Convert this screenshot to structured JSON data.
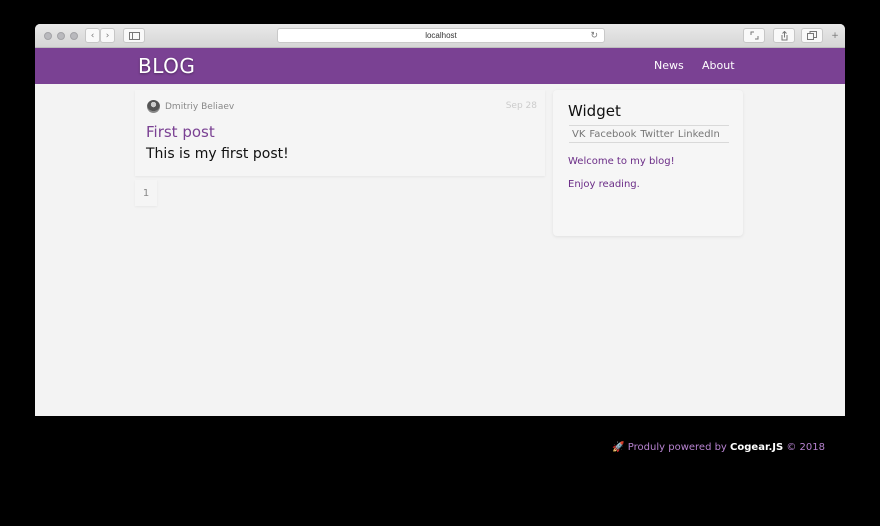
{
  "browser": {
    "url": "localhost"
  },
  "navbar": {
    "logo": "BLOG",
    "links": [
      {
        "label": "News"
      },
      {
        "label": "About"
      }
    ]
  },
  "post": {
    "author": "Dmitriy Beliaev",
    "date": "Sep 28",
    "title": "First post",
    "body": "This is my first post!"
  },
  "pagination": {
    "current_page": "1"
  },
  "widget": {
    "title": "Widget",
    "links": [
      "VK",
      "Facebook",
      "Twitter",
      "LinkedIn"
    ],
    "line1": "Welcome to my blog!",
    "line2": "Enjoy reading."
  },
  "footer": {
    "prefix": "Produly powered by",
    "brand": "Cogear.JS",
    "suffix": "© 2018"
  },
  "colors": {
    "brand": "#7a4193",
    "page_bg": "#f3f3f3"
  }
}
